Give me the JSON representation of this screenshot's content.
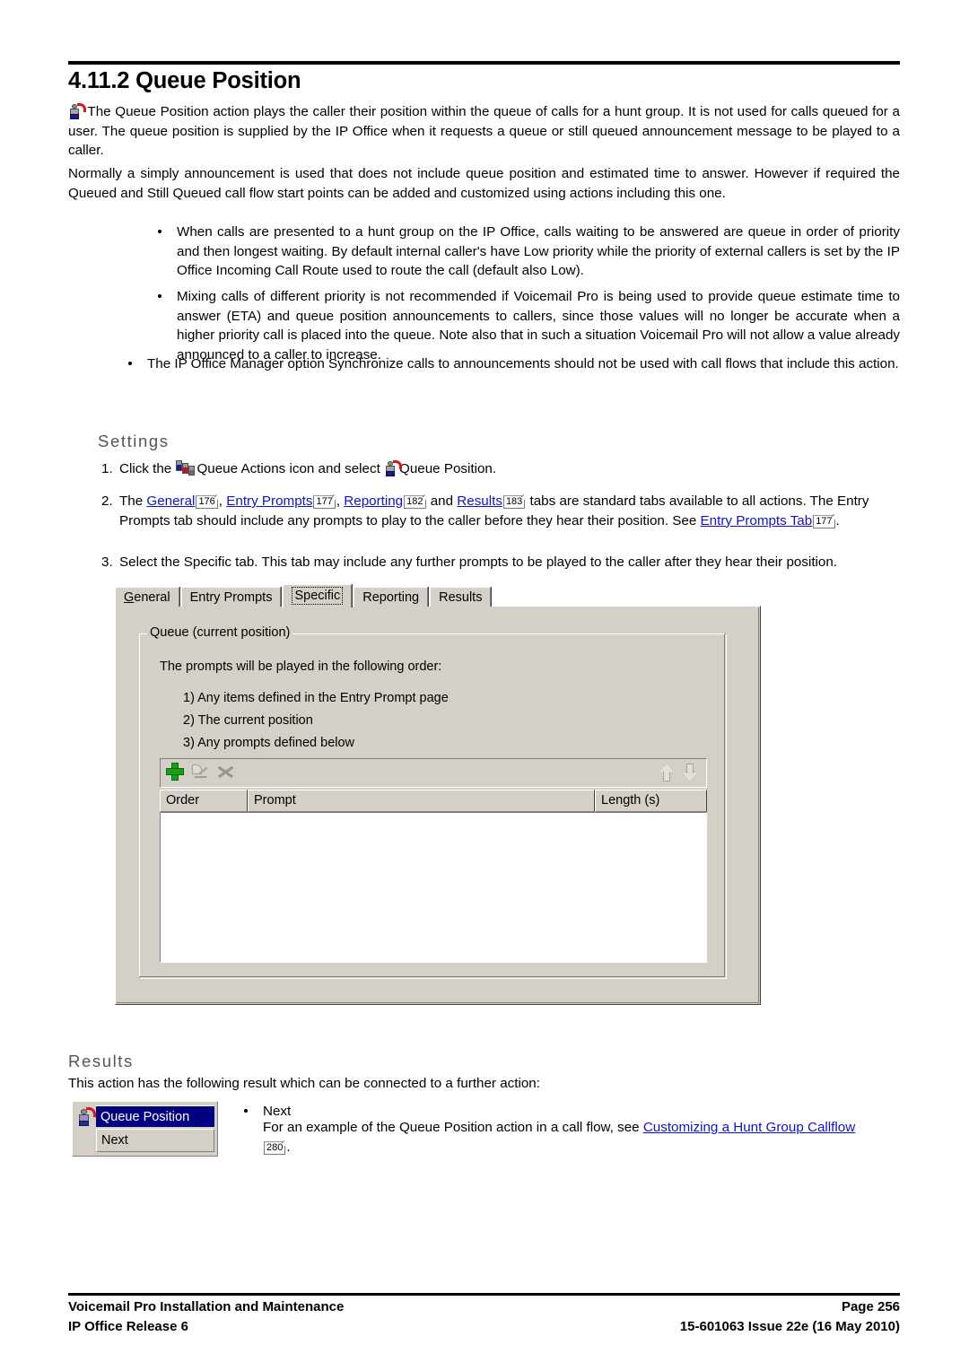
{
  "document": {
    "title": "4.11.2 Queue Position"
  },
  "intro": {
    "icon": "queue-position-icon",
    "paragraph1_part1": "The Queue Position",
    "paragraph1_part2": " action plays the caller their position within the queue of calls for a hunt group. It is not used for calls queued for a user. The queue position is supplied by the IP Office when it requests a queue or still queued announcement message to be played to a caller.",
    "paragraph2": "Normally a simply announcement is used that does not include queue position and estimated time to answer. However if required the Queued and Still Queued call flow start points can be added and customized using actions including this one."
  },
  "bullets": [
    {
      "text": "When calls are presented to a hunt group on the IP Office, calls waiting to be answered are queue in order of priority and then longest waiting. By default internal caller's have Low priority while the priority of external callers is set by the IP Office Incoming Call Route used to route the call (default also Low)."
    },
    {
      "text": "Mixing calls of different priority is not recommended if Voicemail Pro is being used to provide queue estimate time to answer (ETA) and queue position announcements to callers, since those values will no longer be accurate when a higher priority call is placed into the queue. Note also that in such a situation Voicemail Pro will not allow a value already announced to a caller to increase."
    },
    {
      "text": "The IP Office Manager option Synchronize calls to announcements should not be used with call flows that include this action."
    }
  ],
  "settings": {
    "heading": "Settings",
    "step1": {
      "num": "1.",
      "text_before_icon": "Click the ",
      "queue_actions_icon": "queue-actions-icon",
      "text_middle": "Queue Actions icon and select ",
      "queue_position_icon": "queue-position-icon",
      "text_after": "Queue Position."
    },
    "step2": {
      "num": "2.",
      "t0": "The ",
      "link_general": "General",
      "ref_general": "176",
      "t1": ", ",
      "link_entry_prompts": "Entry Prompts",
      "ref_entry_prompts": "177",
      "t2": ", ",
      "link_reporting": "Reporting",
      "ref_reporting": "182",
      "t3": " and ",
      "link_results": "Results",
      "ref_results": "183",
      "t4": " tabs are standard tabs available to all actions. The Entry Prompts tab should include any prompts to play to the caller before they hear their position. See ",
      "link_entry_prompts_tab": "Entry Prompts Tab",
      "ref_entry_prompts_tab": "177",
      "t5": "."
    },
    "step3": {
      "num": "3.",
      "text": "Select the Specific tab. This tab may include any further prompts to be played to the caller after they hear their position."
    }
  },
  "dialog": {
    "tabs": [
      {
        "label": "General",
        "accel": "G",
        "selected": false
      },
      {
        "label": "Entry Prompts",
        "selected": false
      },
      {
        "label": "Specific",
        "selected": true
      },
      {
        "label": "Reporting",
        "selected": false
      },
      {
        "label": "Results",
        "selected": false
      }
    ],
    "groupbox": {
      "title": "Queue (current position)",
      "lead": "The prompts will be played in the following order:",
      "items": [
        "1) Any items defined in the Entry Prompt page",
        "2) The current position",
        "3) Any prompts defined below"
      ]
    },
    "toolbar": {
      "add_icon": "add-plus-icon",
      "edit_icon": "edit-record-icon",
      "tools_icon": "tools-icon",
      "move_up_icon": "arrow-up-icon",
      "move_down_icon": "arrow-down-icon"
    },
    "list": {
      "columns": [
        "Order",
        "Prompt",
        "Length (s)"
      ],
      "rows": []
    }
  },
  "results": {
    "heading": "Results",
    "intro": "This action has the following result which can be connected to a further action:",
    "widget": {
      "icon": "queue-position-icon",
      "title": "Queue Position",
      "connector": "Next"
    },
    "bullet_label": "Next",
    "detail_before": "For an example of the Queue Position action in a call flow, see ",
    "detail_link": "Customizing a Hunt Group Callflow",
    "detail_ref": "280",
    "detail_after": "."
  },
  "footer": {
    "left_line1": "Voicemail Pro Installation and Maintenance",
    "left_line2": "IP Office Release 6",
    "right_line1": "Page 256",
    "right_line2": "15-601063 Issue 22e (16 May 2010)"
  },
  "colors": {
    "link": "#1111cc",
    "dialog_face": "#d4d0c8",
    "title_bar": "#000080",
    "heading_grey": "#555555"
  }
}
